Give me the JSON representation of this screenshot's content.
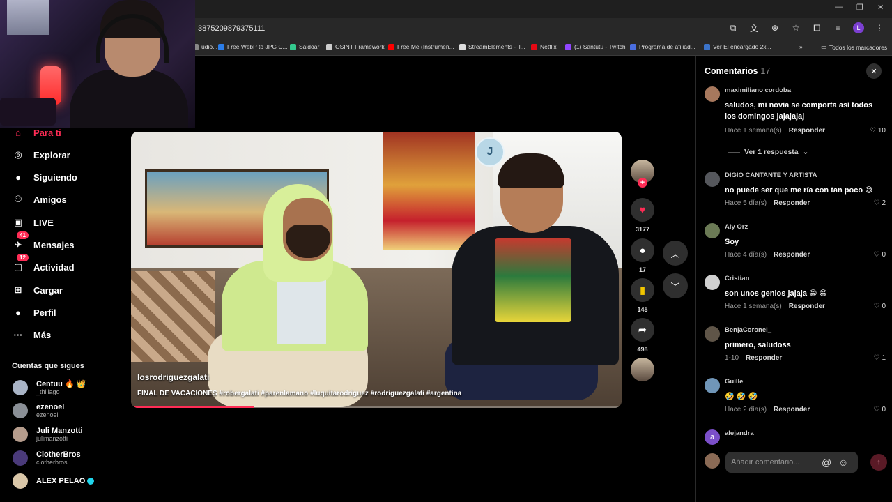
{
  "browser": {
    "url_fragment": "3875209879375111",
    "profile_initial": "L",
    "bookmarks": [
      {
        "label": "udio...",
        "color": "#888888"
      },
      {
        "label": "Free WebP to JPG C...",
        "color": "#2b7de9"
      },
      {
        "label": "Saldoar",
        "color": "#34c98e"
      },
      {
        "label": "OSINT Framework",
        "color": "#cccccc"
      },
      {
        "label": "Free Me (Instrumen...",
        "color": "#ff0000"
      },
      {
        "label": "StreamElements - Il...",
        "color": "#dddddd"
      },
      {
        "label": "Netflix",
        "color": "#e50914"
      },
      {
        "label": "(1) Santutu - Twitch",
        "color": "#9146ff"
      },
      {
        "label": "Programa de afiliad...",
        "color": "#4a6ee0"
      },
      {
        "label": "Ver El encargado 2x...",
        "color": "#3b73c9"
      }
    ],
    "all_bookmarks": "Todos los marcadores",
    "more_bookmarks": "»"
  },
  "sidebar": {
    "items": [
      {
        "label": "Para ti",
        "icon": "home-icon",
        "glyph": "⌂",
        "badge": ""
      },
      {
        "label": "Explorar",
        "icon": "compass-icon",
        "glyph": "◎",
        "badge": ""
      },
      {
        "label": "Siguiendo",
        "icon": "following-avatar-icon",
        "glyph": "●",
        "badge": ""
      },
      {
        "label": "Amigos",
        "icon": "friends-icon",
        "glyph": "⚇",
        "badge": ""
      },
      {
        "label": "LIVE",
        "icon": "live-icon",
        "glyph": "▣",
        "badge": ""
      },
      {
        "label": "Mensajes",
        "icon": "messages-icon",
        "glyph": "✈",
        "badge": "41"
      },
      {
        "label": "Actividad",
        "icon": "activity-icon",
        "glyph": "▢",
        "badge": "12"
      },
      {
        "label": "Cargar",
        "icon": "upload-icon",
        "glyph": "⊞",
        "badge": ""
      },
      {
        "label": "Perfil",
        "icon": "profile-avatar-icon",
        "glyph": "●",
        "badge": ""
      },
      {
        "label": "Más",
        "icon": "more-icon",
        "glyph": "···",
        "badge": ""
      }
    ],
    "following_title": "Cuentas que sigues",
    "following": [
      {
        "name": "Centuu 🔥 👑",
        "handle": "_thiiiago",
        "verified": false
      },
      {
        "name": "ezenoel",
        "handle": "ezenoel",
        "verified": false
      },
      {
        "name": "Juli Manzotti",
        "handle": "julimanzotti",
        "verified": false
      },
      {
        "name": "ClotherBros",
        "handle": "clotherbros",
        "verified": false
      },
      {
        "name": "ALEX PELAO",
        "handle": "",
        "verified": true
      }
    ]
  },
  "video": {
    "author": "losrodriguezgalati",
    "description": "FINAL DE VACACIONES #robergalati #parenlamano #luquitarodriguez #rodriguezgalati #argentina",
    "progress": 0.25,
    "watermark": "J"
  },
  "actions": {
    "likes": "3177",
    "comments": "17",
    "saves": "145",
    "shares": "498"
  },
  "comments_panel": {
    "title": "Comentarios",
    "count": "17",
    "view_replies": "Ver 1 respuesta",
    "reply_label": "Responder",
    "input_placeholder": "Añadir comentario...",
    "items": [
      {
        "user": "maximiliano cordoba",
        "text": "saludos, mi novia se comporta así todos los domingos jajajajaj",
        "time": "Hace 1 semana(s)",
        "likes": "10",
        "avatar": "#a7785d"
      },
      {
        "user": "DIGIO CANTANTE Y ARTISTA",
        "text": "no puede ser que me ría con tan poco 😅",
        "time": "Hace 5 día(s)",
        "likes": "2",
        "avatar": "#55575c"
      },
      {
        "user": "Aly Orz",
        "text": "Soy",
        "time": "Hace 4 día(s)",
        "likes": "0",
        "avatar": "#6b7a55"
      },
      {
        "user": "Cristian",
        "text": "son unos genios jajaja 😄 😄",
        "time": "Hace 1 semana(s)",
        "likes": "0",
        "avatar": "#cfcfcf"
      },
      {
        "user": "BenjaCoronel_",
        "text": "primero, saludoss",
        "time": "1-10",
        "likes": "1",
        "avatar": "#5f5548"
      },
      {
        "user": "Guille",
        "text": "🤣 🤣 🤣",
        "time": "Hace 2 día(s)",
        "likes": "0",
        "avatar": "#7096b8"
      },
      {
        "user": "alejandra",
        "text": "",
        "time": "",
        "likes": "",
        "avatar": "#7b4fc9"
      }
    ],
    "last_avatar_letter": "a"
  },
  "colors": {
    "accent": "#fe2c55",
    "panel": "#2f2f2f"
  }
}
